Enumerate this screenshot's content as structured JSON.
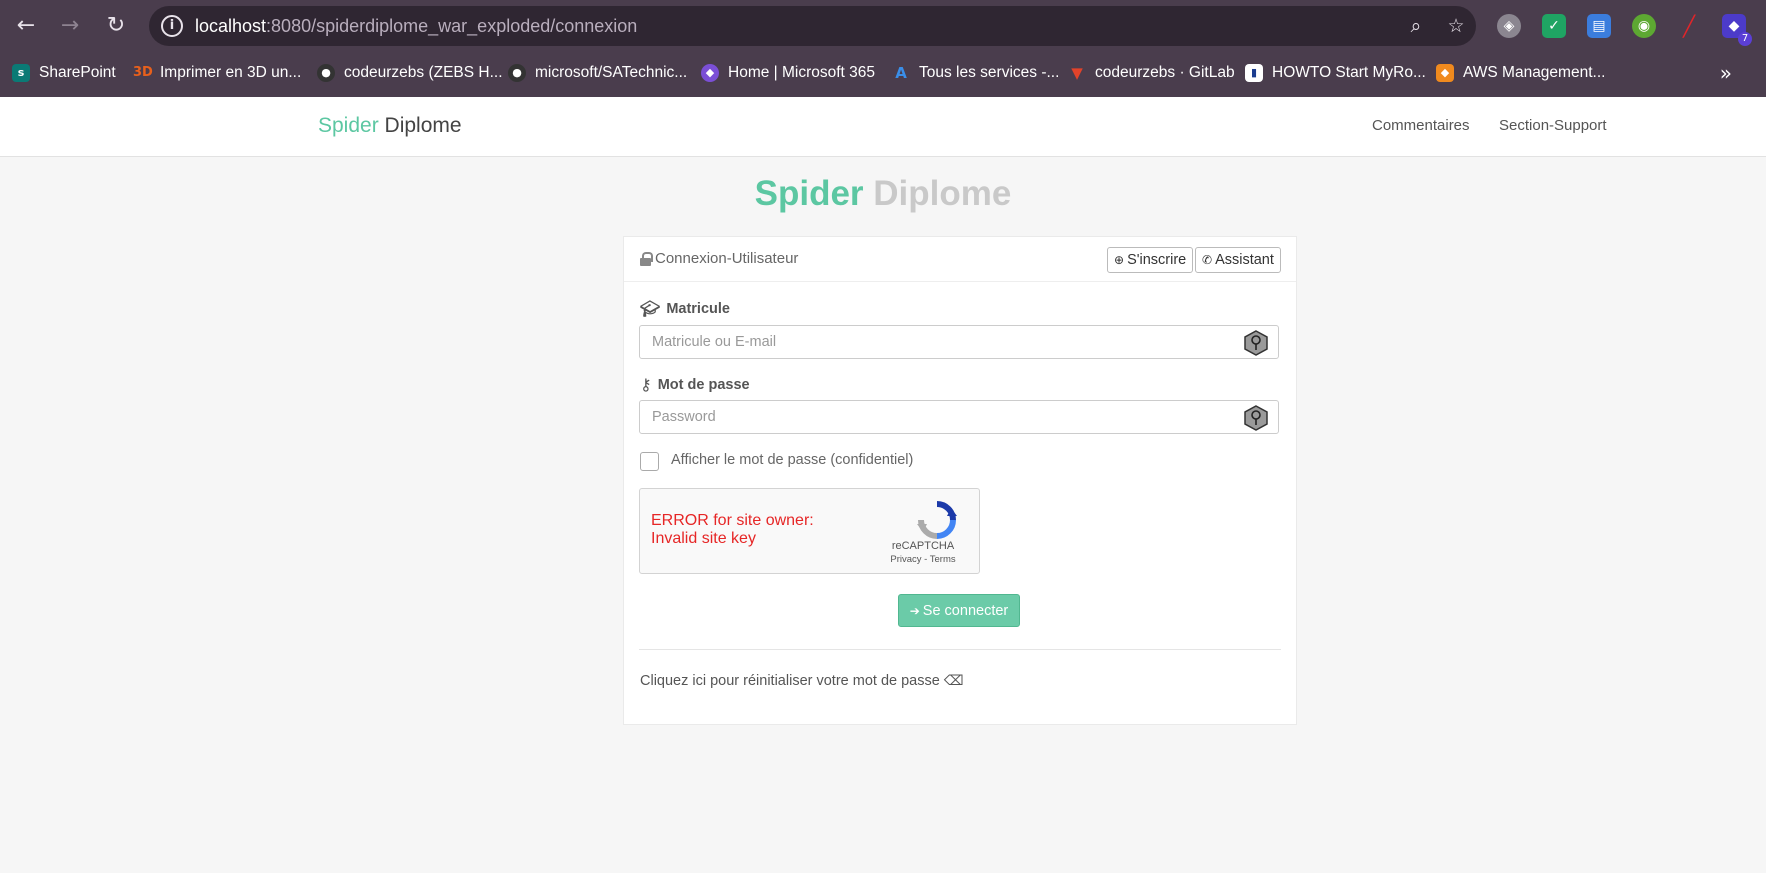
{
  "browser": {
    "url_host": "localhost",
    "url_path": ":8080/spiderdiplome_war_exploded/connexion",
    "extension_badge": "7",
    "bookmarks": [
      {
        "label": "SharePoint",
        "icon": "sharepoint-icon",
        "color": "#0b7a75",
        "glyph": "s"
      },
      {
        "label": "Imprimer en 3D un...",
        "icon": "3d-print-icon",
        "color": "#e8601c",
        "glyph": "3D"
      },
      {
        "label": "codeurzebs (ZEBS H...",
        "icon": "github-icon",
        "color": "#333333",
        "glyph": "●"
      },
      {
        "label": "microsoft/SATechnic...",
        "icon": "github-icon",
        "color": "#333333",
        "glyph": "●"
      },
      {
        "label": "Home | Microsoft 365",
        "icon": "microsoft365-icon",
        "color": "#7b4fd6",
        "glyph": "◆"
      },
      {
        "label": "Tous les services -...",
        "icon": "azure-icon",
        "color": "#1e76d2",
        "glyph": "A"
      },
      {
        "label": "codeurzebs · GitLab",
        "icon": "gitlab-icon",
        "color": "#e2432a",
        "glyph": "▼"
      },
      {
        "label": "HOWTO Start MyRo...",
        "icon": "howto-icon",
        "color": "#ffffff",
        "glyph": "▮"
      },
      {
        "label": "AWS Management...",
        "icon": "aws-icon",
        "color": "#f08a1e",
        "glyph": "◆"
      }
    ]
  },
  "navbar": {
    "brand_spider": "Spider",
    "brand_diplome": "Diplome",
    "links": [
      "Commentaires",
      "Section-Support"
    ]
  },
  "heading": {
    "spider": "Spider",
    "diplome": "Diplome"
  },
  "panel": {
    "title": "Connexion-Utilisateur",
    "signup_label": "S'inscrire",
    "assistant_label": "Assistant",
    "matricule_label": "Matricule",
    "matricule_placeholder": "Matricule ou E-mail",
    "password_label": "Mot de passe",
    "password_placeholder": "Password",
    "show_password_label": "Afficher le mot de passe (confidentiel)",
    "recaptcha_error": "ERROR for site owner: Invalid site key",
    "recaptcha_brand": "reCAPTCHA",
    "recaptcha_links": "Privacy - Terms",
    "submit_label": "Se connecter",
    "reset_text": "Cliquez ici pour réinitialiser votre mot de passe"
  },
  "colors": {
    "accent": "#5cc7a2",
    "submit": "#6bcba8",
    "error": "#e62626",
    "chrome": "#4a3d4d"
  }
}
